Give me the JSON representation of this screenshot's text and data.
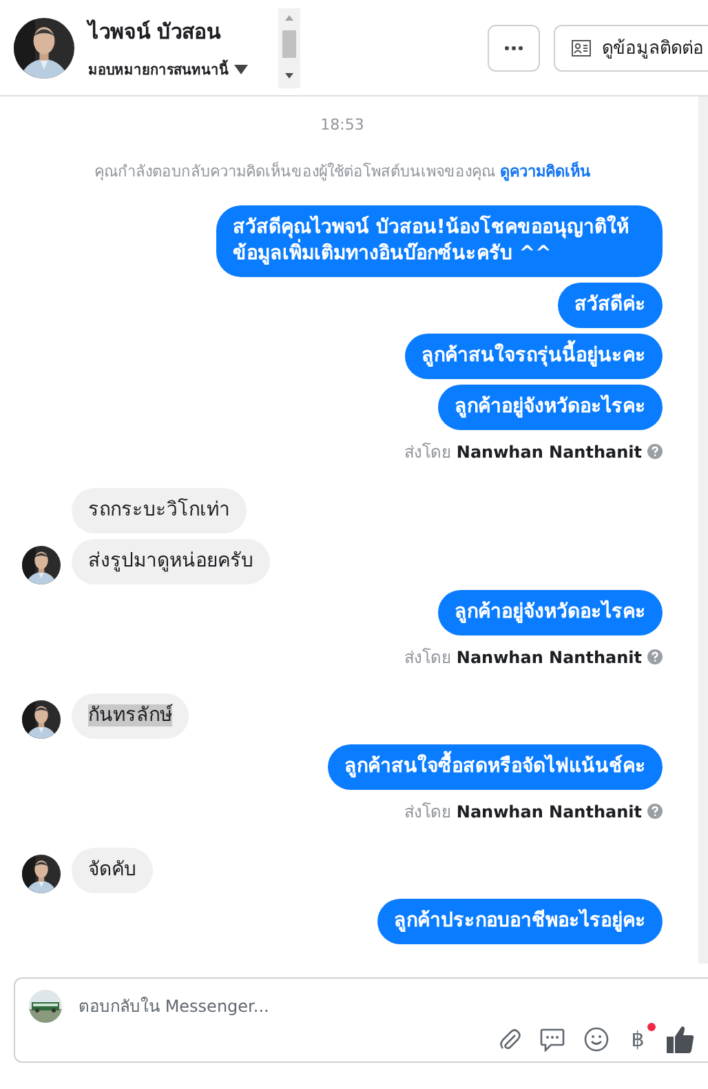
{
  "header": {
    "name": "ไวพจน์ บัวสอน",
    "assign_label": "มอบหมายการสนทนานี้",
    "contact_button": "ดูข้อมูลติดต่อ"
  },
  "thread": {
    "timestamp": "18:53",
    "notice": "คุณกำลังตอบกลับความคิดเห็นของผู้ใช้ต่อโพสต์บนเพจของคุณ",
    "notice_link": "ดูความคิดเห็น",
    "messages": [
      {
        "kind": "out",
        "text": "สวัสดีคุณไวพจน์ บัวสอน!น้องโชคขออนุญาติให้ข้อมูลเพิ่มเติมทางอินบ๊อกซ์นะครับ ^^"
      },
      {
        "kind": "out",
        "text": "สวัสดีค่ะ"
      },
      {
        "kind": "out",
        "text": "ลูกค้าสนใจรถรุ่นนี้อยู่นะคะ"
      },
      {
        "kind": "out",
        "text": "ลูกค้าอยู่จังหวัดอะไรคะ"
      },
      {
        "kind": "meta",
        "text": "ส่งโดย **Nanwhan Nanthanit**"
      },
      {
        "kind": "in",
        "text": "รถกระบะวิโกเท่า",
        "avatar": false,
        "highlighted": false
      },
      {
        "kind": "in",
        "text": "ส่งรูปมาดูหน่อยครับ",
        "avatar": true,
        "highlighted": false
      },
      {
        "kind": "out",
        "text": "ลูกค้าอยู่จังหวัดอะไรคะ"
      },
      {
        "kind": "meta",
        "text": "ส่งโดย **Nanwhan Nanthanit**"
      },
      {
        "kind": "in",
        "text": "กันทรลักษ์",
        "avatar": true,
        "highlighted": true
      },
      {
        "kind": "out",
        "text": "ลูกค้าสนใจซื้อสดหรือจัดไฟแน้นช์คะ"
      },
      {
        "kind": "meta",
        "text": "ส่งโดย **Nanwhan Nanthanit**"
      },
      {
        "kind": "in",
        "text": "จัดคับ",
        "avatar": true,
        "highlighted": false
      },
      {
        "kind": "out",
        "text": "ลูกค้าประกอบอาชีพอะไรอยู่คะ"
      }
    ]
  },
  "composer": {
    "placeholder": "ตอบกลับใน Messenger...",
    "currency_symbol": "฿",
    "currency_badge": true
  }
}
